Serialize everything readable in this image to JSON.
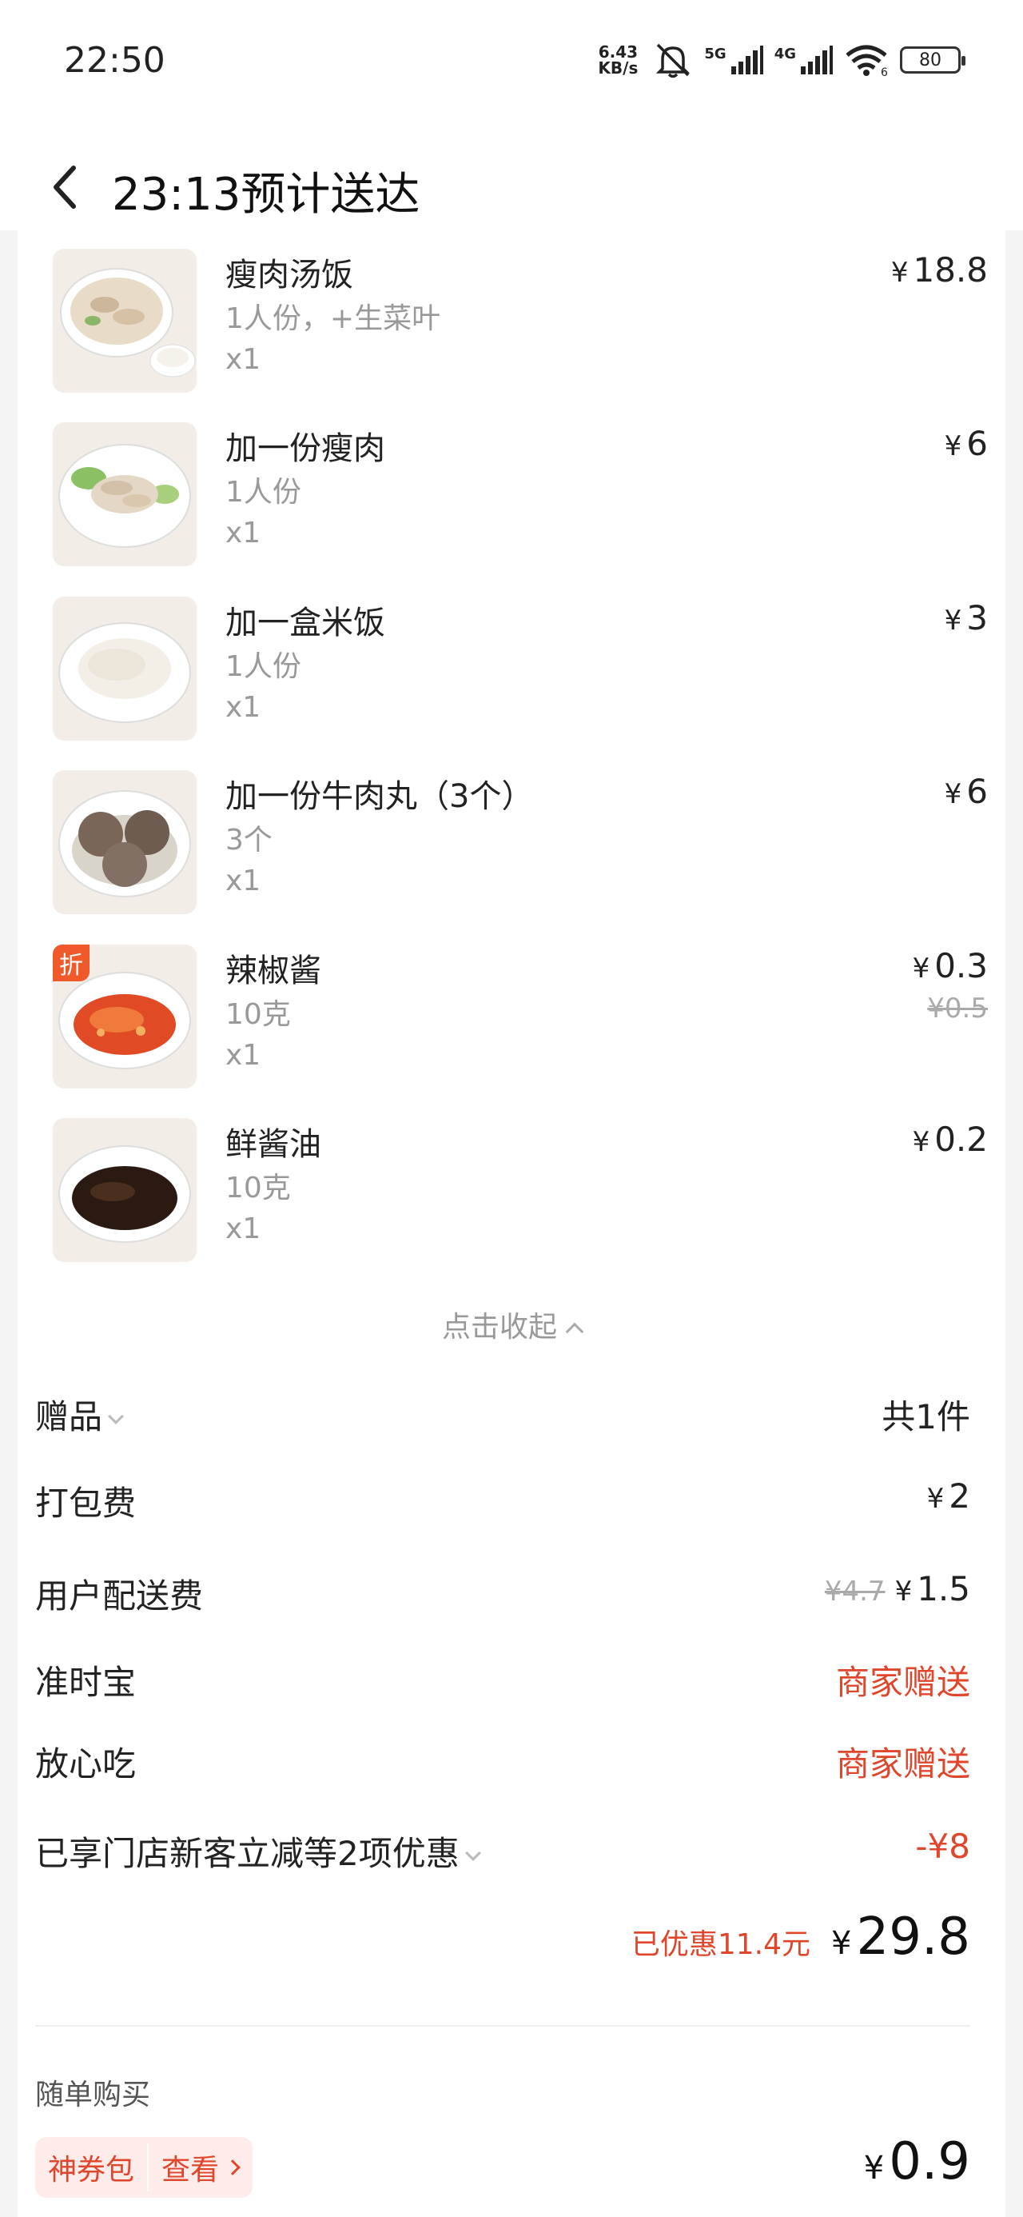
{
  "status_bar": {
    "time": "22:50",
    "net_speed_value": "6.43",
    "net_speed_unit": "KB/s",
    "sig1": "5G",
    "sig2": "4G",
    "wifi_label": "6",
    "battery": "80"
  },
  "header": {
    "title": "23:13预计送达"
  },
  "items": [
    {
      "name": "瘦肉汤饭",
      "spec": "1人份，+生菜叶",
      "qty": "x1",
      "currency": "¥",
      "price": "18.8",
      "image": "lean-pork-soup-rice"
    },
    {
      "name": "加一份瘦肉",
      "spec": "1人份",
      "qty": "x1",
      "currency": "¥",
      "price": "6",
      "image": "lean-pork"
    },
    {
      "name": "加一盒米饭",
      "spec": "1人份",
      "qty": "x1",
      "currency": "¥",
      "price": "3",
      "image": "rice"
    },
    {
      "name": "加一份牛肉丸（3个）",
      "spec": "3个",
      "qty": "x1",
      "currency": "¥",
      "price": "6",
      "image": "beef-balls"
    },
    {
      "name": "辣椒酱",
      "spec": "10克",
      "qty": "x1",
      "currency": "¥",
      "price": "0.3",
      "original_price": "¥0.5",
      "discount_tag": "折",
      "image": "chili-sauce"
    },
    {
      "name": "鲜酱油",
      "spec": "10克",
      "qty": "x1",
      "currency": "¥",
      "price": "0.2",
      "image": "soy-sauce"
    }
  ],
  "collapse_label": "点击收起",
  "summary": {
    "gift_label": "赠品",
    "gift_value": "共1件",
    "packing_label": "打包费",
    "packing_value": "2",
    "delivery_label": "用户配送费",
    "delivery_original": "¥4.7",
    "delivery_value": "1.5",
    "ontime_label": "准时宝",
    "ontime_value": "商家赠送",
    "safe_label": "放心吃",
    "safe_value": "商家赠送",
    "discount_label": "已享门店新客立减等2项优惠",
    "discount_value": "-¥8",
    "saved_text": "已优惠11.4元",
    "currency": "¥",
    "total": "29.8"
  },
  "addon": {
    "section_title": "随单购买",
    "coupon_label": "神券包",
    "view_label": "查看",
    "currency": "¥",
    "price": "0.9"
  },
  "colors": {
    "accent_red": "#e0462b",
    "discount_tag_bg": "#f05a2b"
  }
}
